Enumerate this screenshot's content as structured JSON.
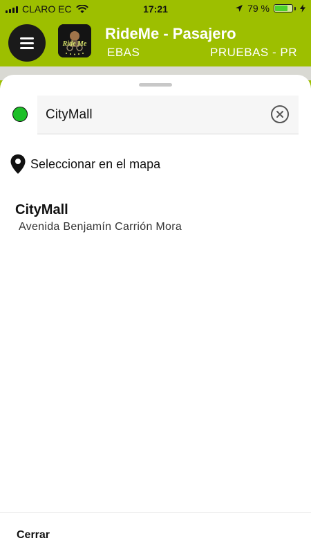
{
  "status_bar": {
    "carrier": "CLARO EC",
    "time": "17:21",
    "battery_percent": "79 %",
    "battery_level": 0.79
  },
  "header": {
    "title": "RideMe - Pasajero",
    "subtitle_left": "EBAS",
    "subtitle_right": "PRUEBAS - PR",
    "logo_text": "Ride Me",
    "background_color": "#9dbf00"
  },
  "search": {
    "value": "CityMall",
    "origin_color": "#1dbf28"
  },
  "select_on_map": {
    "label": "Seleccionar en el mapa"
  },
  "results": [
    {
      "title": "CityMall",
      "subtitle": "Avenida Benjamín Carrión Mora"
    }
  ],
  "footer": {
    "close_label": "Cerrar"
  }
}
